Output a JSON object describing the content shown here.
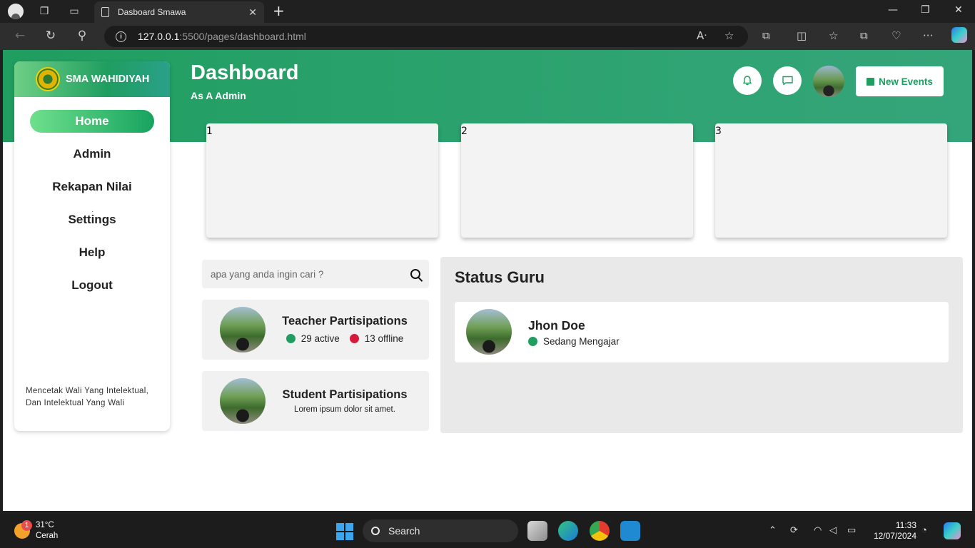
{
  "browser": {
    "tab_title": "Dasboard Smawa",
    "url_host": "127.0.0.1",
    "url_path": ":5500/pages/dashboard.html"
  },
  "sidebar": {
    "brand": "SMA WAHIDIYAH",
    "items": [
      {
        "label": "Home",
        "active": true
      },
      {
        "label": "Admin"
      },
      {
        "label": "Rekapan Nilai"
      },
      {
        "label": "Settings"
      },
      {
        "label": "Help"
      },
      {
        "label": "Logout"
      }
    ],
    "tagline": "Mencetak Wali Yang Intelektual, Dan Intelektual Yang Wali"
  },
  "header": {
    "title": "Dashboard",
    "subtitle": "As A Admin",
    "new_events_label": "New Events",
    "icons": [
      "bell-icon",
      "chat-icon",
      "calendar-icon"
    ]
  },
  "stat_cards": [
    "1",
    "2",
    "3"
  ],
  "search": {
    "placeholder": "apa yang anda ingin cari ?"
  },
  "teacher_participation": {
    "title": "Teacher Partisipations",
    "active": "29 active",
    "offline": "13 offline"
  },
  "student_participation": {
    "title": "Student Partisipations",
    "description": "Lorem ipsum dolor sit amet."
  },
  "status_guru": {
    "title": "Status Guru",
    "teachers": [
      {
        "name": "Jhon Doe",
        "status": "Sedang Mengajar"
      }
    ]
  },
  "colors": {
    "brand_green": "#1f9e60",
    "active_dot": "#1f9e60",
    "offline_dot": "#d7193a"
  },
  "taskbar": {
    "temp": "31°C",
    "weather": "Cerah",
    "weather_badge": "1",
    "search_label": "Search",
    "time": "11:33",
    "date": "12/07/2024"
  }
}
